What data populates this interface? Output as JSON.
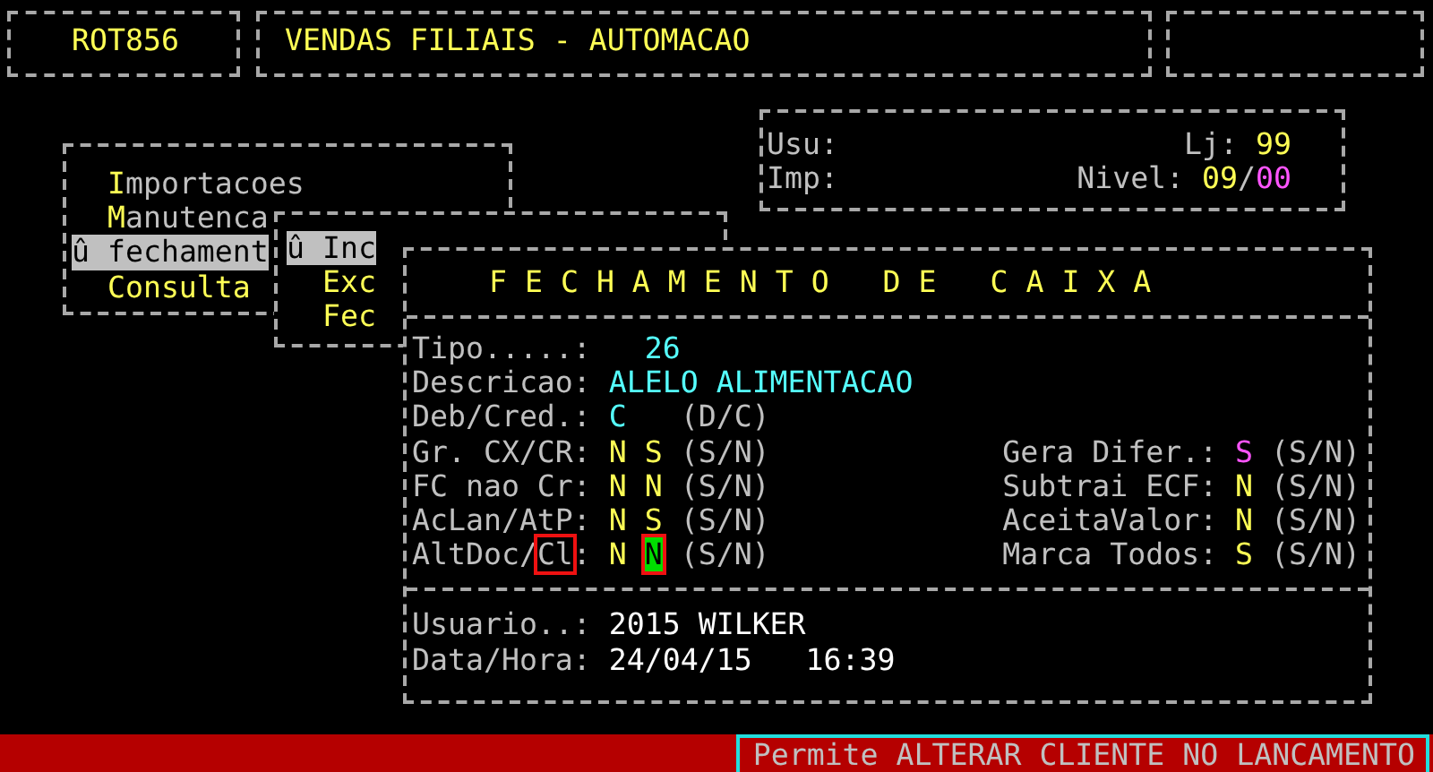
{
  "header": {
    "program_code": "ROT856",
    "title": "VENDAS FILIAIS - AUTOMACAO"
  },
  "info_panel": {
    "user_label": "Usu:",
    "store_label": "Lj:",
    "store_value": "99",
    "printer_label": "Imp:",
    "level_label": "Nivel:",
    "level_value": "09",
    "level_separator": "/",
    "level_profile": "00"
  },
  "main_menu": {
    "items": [
      {
        "selected": false,
        "parts": [
          {
            "text": "I",
            "highlight": true
          },
          {
            "text": "mportacoes",
            "highlight": false
          }
        ]
      },
      {
        "selected": false,
        "parts": [
          {
            "text": "M",
            "highlight": true
          },
          {
            "text": "anutenca",
            "highlight": false
          }
        ]
      },
      {
        "selected": true,
        "parts": [
          {
            "text": "û fechament"
          }
        ]
      },
      {
        "selected": false,
        "parts": [
          {
            "text": "Consulta",
            "highlight": true
          }
        ]
      }
    ]
  },
  "sub_menu": {
    "items": [
      {
        "selected": true,
        "parts": [
          {
            "text": "û Inc"
          }
        ]
      },
      {
        "selected": false,
        "parts": [
          {
            "text": "Exc",
            "highlight": true
          }
        ]
      },
      {
        "selected": false,
        "parts": [
          {
            "text": "Fec",
            "highlight": true
          }
        ]
      }
    ]
  },
  "dialog": {
    "title": "F E C H A M E N T O   D E   C A I X A",
    "fields": [
      {
        "kind": "number",
        "label_parts": [
          {
            "text": "Tipo.....:",
            "marked": false
          }
        ],
        "values": [
          {
            "text": "26",
            "color": "#55ffff",
            "focused": false,
            "marked": false
          }
        ]
      },
      {
        "kind": "text",
        "label_parts": [
          {
            "text": "Descricao:",
            "marked": false
          }
        ],
        "values": [
          {
            "text": "ALELO ALIMENTACAO",
            "color": "#55ffff",
            "focused": false,
            "marked": false
          }
        ]
      },
      {
        "kind": "choice",
        "label_parts": [
          {
            "text": "Deb/Cred.:",
            "marked": false
          }
        ],
        "values": [
          {
            "text": "C",
            "color": "#55ffff",
            "focused": false,
            "marked": false
          }
        ],
        "hint": "(D/C)"
      },
      {
        "kind": "choice",
        "label_parts": [
          {
            "text": "Gr. CX/CR:",
            "marked": false
          }
        ],
        "values": [
          {
            "text": "N",
            "color": "#ffff55",
            "focused": false,
            "marked": false
          },
          {
            "text": "S",
            "color": "#ffff55",
            "focused": false,
            "marked": false
          }
        ],
        "hint": "(S/N)"
      },
      {
        "kind": "choice",
        "label_parts": [
          {
            "text": "FC nao Cr:",
            "marked": false
          }
        ],
        "values": [
          {
            "text": "N",
            "color": "#ffff55",
            "focused": false,
            "marked": false
          },
          {
            "text": "N",
            "color": "#ffff55",
            "focused": false,
            "marked": false
          }
        ],
        "hint": "(S/N)"
      },
      {
        "kind": "choice",
        "label_parts": [
          {
            "text": "AcLan/AtP:",
            "marked": false
          }
        ],
        "values": [
          {
            "text": "N",
            "color": "#ffff55",
            "focused": false,
            "marked": false
          },
          {
            "text": "S",
            "color": "#ffff55",
            "focused": false,
            "marked": false
          }
        ],
        "hint": "(S/N)"
      },
      {
        "kind": "choice",
        "label_parts": [
          {
            "text": "AltDoc/",
            "marked": false
          },
          {
            "text": "Cl",
            "marked": true
          },
          {
            "text": ":",
            "marked": false
          }
        ],
        "values": [
          {
            "text": "N",
            "color": "#ffff55",
            "focused": false,
            "marked": false
          },
          {
            "text": "N",
            "focused": true,
            "marked": true
          }
        ],
        "hint": "(S/N)"
      }
    ],
    "options": [
      {
        "label": "Gera Difer.:",
        "value": "S",
        "color": "#ff55ff",
        "hint": "(S/N)"
      },
      {
        "label": "Subtrai ECF:",
        "value": "N",
        "color": "#ffff55",
        "hint": "(S/N)"
      },
      {
        "label": "AceitaValor:",
        "value": "N",
        "color": "#ffff55",
        "hint": "(S/N)"
      },
      {
        "label": "Marca Todos:",
        "value": "S",
        "color": "#ffff55",
        "hint": "(S/N)"
      }
    ],
    "footer": {
      "user_label": "Usuario..:",
      "user_value": "2015 WILKER",
      "datetime_label": "Data/Hora:",
      "date_value": "24/04/15",
      "time_value": "16:39"
    }
  },
  "status_bar": {
    "message": "Permite ALTERAR CLIENTE NO LANCAMENTO"
  }
}
